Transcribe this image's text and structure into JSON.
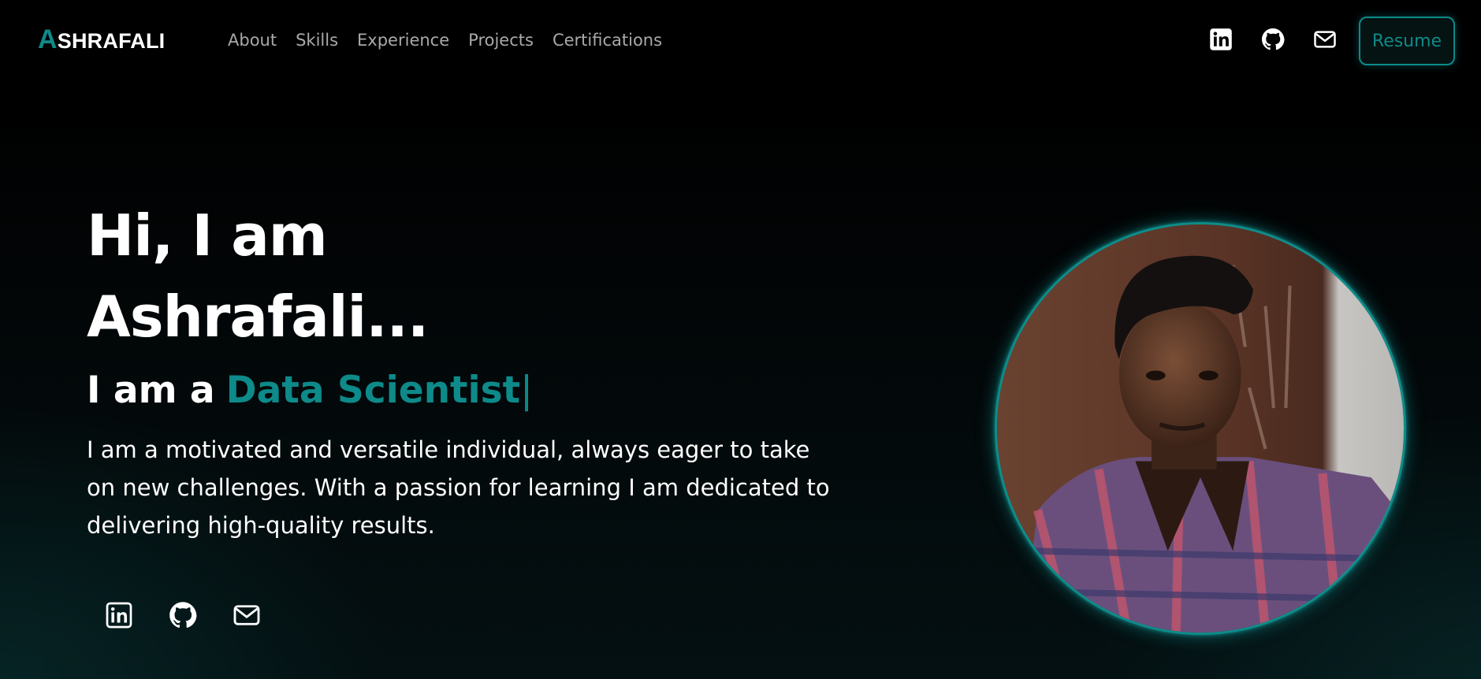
{
  "brand": {
    "first_letter": "A",
    "rest": "SHRAFALI",
    "accent_color": "#0d8a89"
  },
  "nav": {
    "links": [
      {
        "label": "About"
      },
      {
        "label": "Skills"
      },
      {
        "label": "Experience"
      },
      {
        "label": "Projects"
      },
      {
        "label": "Certifications"
      }
    ],
    "icons": [
      "linkedin-icon",
      "github-icon",
      "mail-icon"
    ],
    "resume_label": "Resume"
  },
  "hero": {
    "title_line1": "Hi, I am",
    "title_line2": "Ashrafali...",
    "role_prefix": "I am a",
    "role_typed": "Data Scientist",
    "role_cursor": "|",
    "bio": "I am a motivated and versatile individual, always eager to take on new challenges. With a passion for learning I am dedicated to delivering high-quality results.",
    "social_icons": [
      "linkedin-icon",
      "github-icon",
      "mail-icon"
    ]
  },
  "profile_photo": {
    "description_icon": "profile-photo"
  },
  "colors": {
    "background": "#020303",
    "accent": "#0d8a89",
    "nav_text": "#a9a9a9",
    "text": "#ffffff"
  }
}
